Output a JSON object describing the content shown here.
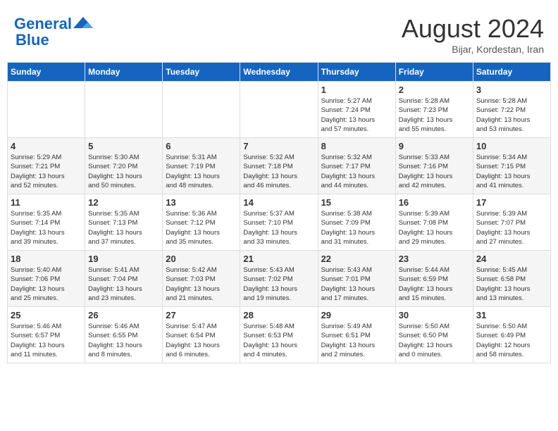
{
  "header": {
    "logo_line1": "General",
    "logo_line2": "Blue",
    "month_title": "August 2024",
    "subtitle": "Bijar, Kordestan, Iran"
  },
  "weekdays": [
    "Sunday",
    "Monday",
    "Tuesday",
    "Wednesday",
    "Thursday",
    "Friday",
    "Saturday"
  ],
  "weeks": [
    [
      {
        "day": "",
        "info": ""
      },
      {
        "day": "",
        "info": ""
      },
      {
        "day": "",
        "info": ""
      },
      {
        "day": "",
        "info": ""
      },
      {
        "day": "1",
        "info": "Sunrise: 5:27 AM\nSunset: 7:24 PM\nDaylight: 13 hours\nand 57 minutes."
      },
      {
        "day": "2",
        "info": "Sunrise: 5:28 AM\nSunset: 7:23 PM\nDaylight: 13 hours\nand 55 minutes."
      },
      {
        "day": "3",
        "info": "Sunrise: 5:28 AM\nSunset: 7:22 PM\nDaylight: 13 hours\nand 53 minutes."
      }
    ],
    [
      {
        "day": "4",
        "info": "Sunrise: 5:29 AM\nSunset: 7:21 PM\nDaylight: 13 hours\nand 52 minutes."
      },
      {
        "day": "5",
        "info": "Sunrise: 5:30 AM\nSunset: 7:20 PM\nDaylight: 13 hours\nand 50 minutes."
      },
      {
        "day": "6",
        "info": "Sunrise: 5:31 AM\nSunset: 7:19 PM\nDaylight: 13 hours\nand 48 minutes."
      },
      {
        "day": "7",
        "info": "Sunrise: 5:32 AM\nSunset: 7:18 PM\nDaylight: 13 hours\nand 46 minutes."
      },
      {
        "day": "8",
        "info": "Sunrise: 5:32 AM\nSunset: 7:17 PM\nDaylight: 13 hours\nand 44 minutes."
      },
      {
        "day": "9",
        "info": "Sunrise: 5:33 AM\nSunset: 7:16 PM\nDaylight: 13 hours\nand 42 minutes."
      },
      {
        "day": "10",
        "info": "Sunrise: 5:34 AM\nSunset: 7:15 PM\nDaylight: 13 hours\nand 41 minutes."
      }
    ],
    [
      {
        "day": "11",
        "info": "Sunrise: 5:35 AM\nSunset: 7:14 PM\nDaylight: 13 hours\nand 39 minutes."
      },
      {
        "day": "12",
        "info": "Sunrise: 5:35 AM\nSunset: 7:13 PM\nDaylight: 13 hours\nand 37 minutes."
      },
      {
        "day": "13",
        "info": "Sunrise: 5:36 AM\nSunset: 7:12 PM\nDaylight: 13 hours\nand 35 minutes."
      },
      {
        "day": "14",
        "info": "Sunrise: 5:37 AM\nSunset: 7:10 PM\nDaylight: 13 hours\nand 33 minutes."
      },
      {
        "day": "15",
        "info": "Sunrise: 5:38 AM\nSunset: 7:09 PM\nDaylight: 13 hours\nand 31 minutes."
      },
      {
        "day": "16",
        "info": "Sunrise: 5:39 AM\nSunset: 7:08 PM\nDaylight: 13 hours\nand 29 minutes."
      },
      {
        "day": "17",
        "info": "Sunrise: 5:39 AM\nSunset: 7:07 PM\nDaylight: 13 hours\nand 27 minutes."
      }
    ],
    [
      {
        "day": "18",
        "info": "Sunrise: 5:40 AM\nSunset: 7:06 PM\nDaylight: 13 hours\nand 25 minutes."
      },
      {
        "day": "19",
        "info": "Sunrise: 5:41 AM\nSunset: 7:04 PM\nDaylight: 13 hours\nand 23 minutes."
      },
      {
        "day": "20",
        "info": "Sunrise: 5:42 AM\nSunset: 7:03 PM\nDaylight: 13 hours\nand 21 minutes."
      },
      {
        "day": "21",
        "info": "Sunrise: 5:43 AM\nSunset: 7:02 PM\nDaylight: 13 hours\nand 19 minutes."
      },
      {
        "day": "22",
        "info": "Sunrise: 5:43 AM\nSunset: 7:01 PM\nDaylight: 13 hours\nand 17 minutes."
      },
      {
        "day": "23",
        "info": "Sunrise: 5:44 AM\nSunset: 6:59 PM\nDaylight: 13 hours\nand 15 minutes."
      },
      {
        "day": "24",
        "info": "Sunrise: 5:45 AM\nSunset: 6:58 PM\nDaylight: 13 hours\nand 13 minutes."
      }
    ],
    [
      {
        "day": "25",
        "info": "Sunrise: 5:46 AM\nSunset: 6:57 PM\nDaylight: 13 hours\nand 11 minutes."
      },
      {
        "day": "26",
        "info": "Sunrise: 5:46 AM\nSunset: 6:55 PM\nDaylight: 13 hours\nand 8 minutes."
      },
      {
        "day": "27",
        "info": "Sunrise: 5:47 AM\nSunset: 6:54 PM\nDaylight: 13 hours\nand 6 minutes."
      },
      {
        "day": "28",
        "info": "Sunrise: 5:48 AM\nSunset: 6:53 PM\nDaylight: 13 hours\nand 4 minutes."
      },
      {
        "day": "29",
        "info": "Sunrise: 5:49 AM\nSunset: 6:51 PM\nDaylight: 13 hours\nand 2 minutes."
      },
      {
        "day": "30",
        "info": "Sunrise: 5:50 AM\nSunset: 6:50 PM\nDaylight: 13 hours\nand 0 minutes."
      },
      {
        "day": "31",
        "info": "Sunrise: 5:50 AM\nSunset: 6:49 PM\nDaylight: 12 hours\nand 58 minutes."
      }
    ]
  ]
}
